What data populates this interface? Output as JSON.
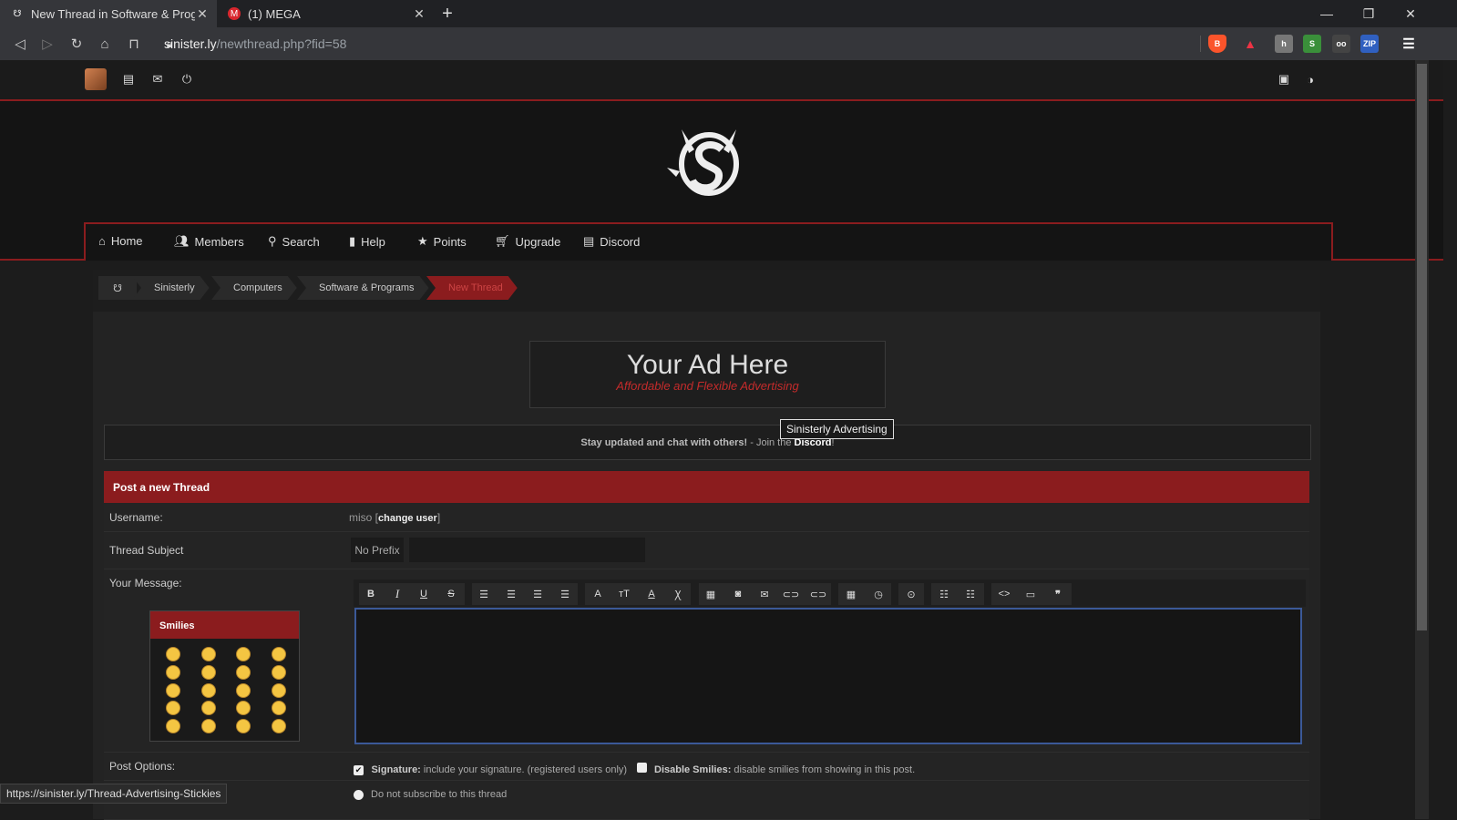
{
  "browser": {
    "tabs": [
      {
        "title": "New Thread in Software & Program",
        "active": true
      },
      {
        "title": "(1) MEGA",
        "active": false
      }
    ],
    "new_tab": "+",
    "url_host": "sinister.ly",
    "url_path": "/newthread.php?fid=58"
  },
  "nav": {
    "items": [
      "Home",
      "Members",
      "Search",
      "Help",
      "Points",
      "Upgrade",
      "Discord"
    ]
  },
  "breadcrumb": [
    "Sinisterly",
    "Computers",
    "Software & Programs",
    "New Thread"
  ],
  "ad": {
    "title": "Your Ad Here",
    "subtitle": "Affordable and Flexible Advertising",
    "tooltip": "Sinisterly Advertising"
  },
  "announce": {
    "text": "Stay updated and chat with others!",
    "join": " - Join the ",
    "link": "Discord",
    "end": "!"
  },
  "form": {
    "header": "Post a new Thread",
    "username_label": "Username:",
    "username_value": "miso",
    "change_user": "change user",
    "subject_label": "Thread Subject",
    "prefix": "No Prefix",
    "message_label": "Your Message:",
    "smilies_title": "Smilies",
    "options_label": "Post Options:",
    "signature_label": "Signature:",
    "signature_desc": " include your signature. (registered users only)",
    "disable_smilies_label": "Disable Smilies:",
    "disable_smilies_desc": " disable smilies from showing in this post.",
    "subscribe_option": "Do not subscribe to this thread"
  },
  "status_url": "https://sinister.ly/Thread-Advertising-Stickies",
  "colors": {
    "accent": "#8b1c1e",
    "editor_border": "#3b5998"
  }
}
